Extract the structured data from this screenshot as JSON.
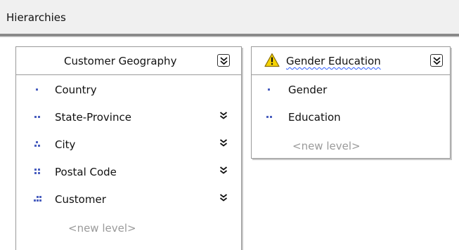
{
  "panel": {
    "title": "Hierarchies"
  },
  "hierarchies": [
    {
      "name": "Customer Geography",
      "levels": [
        {
          "label": "Country",
          "icon": "level-1-icon",
          "chevron": false
        },
        {
          "label": "State-Province",
          "icon": "level-2-icon",
          "chevron": true
        },
        {
          "label": "City",
          "icon": "level-3-icon",
          "chevron": true
        },
        {
          "label": "Postal Code",
          "icon": "level-4-icon",
          "chevron": true
        },
        {
          "label": "Customer",
          "icon": "level-5-icon",
          "chevron": true
        }
      ],
      "new_level": "<new level>"
    },
    {
      "name": "Gender Education",
      "warning": true,
      "levels": [
        {
          "label": "Gender",
          "icon": "level-1-icon",
          "chevron": false
        },
        {
          "label": "Education",
          "icon": "level-2-icon",
          "chevron": false
        }
      ],
      "new_level": "<new level>"
    }
  ],
  "colors": {
    "level_icon": "#4a5fbf",
    "warning": "#f5d300",
    "underline": "#2c5cff",
    "placeholder": "#9a9a9a"
  }
}
